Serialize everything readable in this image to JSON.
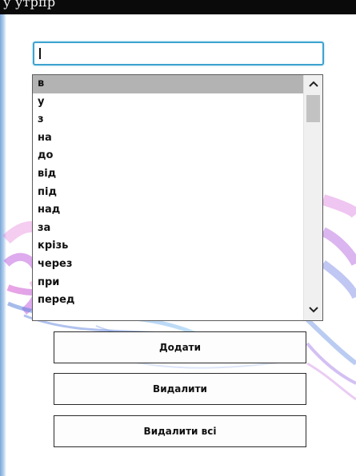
{
  "window": {
    "title_fragment": "у утрпр"
  },
  "input": {
    "value": "",
    "placeholder": ""
  },
  "list": {
    "items": [
      "в",
      "у",
      "з",
      "на",
      "до",
      "від",
      "під",
      "над",
      "за",
      "крізь",
      "через",
      "при",
      "перед"
    ],
    "selected_index": 0
  },
  "scrollbar": {
    "up_icon": "chevron-up-icon",
    "down_icon": "chevron-down-icon"
  },
  "buttons": {
    "add_label": "Додати",
    "remove_label": "Видалити",
    "remove_all_label": "Видалити всі"
  },
  "colors": {
    "title_bar": "#0a0a0a",
    "input_border": "#3ea3cf",
    "selected_row": "#b3b3b3",
    "scroll_thumb": "#c2c2c2",
    "button_border": "#2a2a2a"
  }
}
